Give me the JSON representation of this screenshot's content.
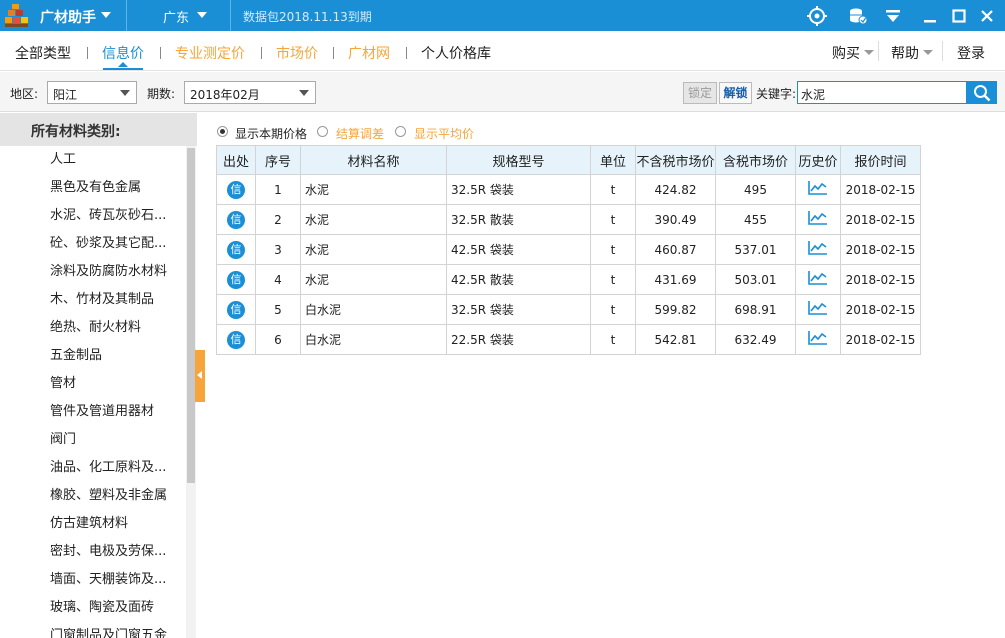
{
  "titlebar": {
    "app_name": "广材助手",
    "region": "广东",
    "package_text": "数据包2018.11.13到期",
    "icons": [
      "target-icon",
      "database-icon",
      "download-icon",
      "minimize-icon",
      "maximize-icon",
      "close-icon"
    ]
  },
  "nav": {
    "tabs": [
      "全部类型",
      "信息价",
      "专业测定价",
      "市场价",
      "广材网",
      "个人价格库"
    ],
    "active_tab": "信息价",
    "buy_label": "购买",
    "help_label": "帮助",
    "login_label": "登录"
  },
  "filter": {
    "area_label": "地区:",
    "area_value": "阳江",
    "period_label": "期数:",
    "period_value": "2018年02月",
    "lock_label": "锁定",
    "unlock_label": "解锁",
    "keyword_label": "关键字:",
    "keyword_value": "水泥"
  },
  "sidebar": {
    "header": "所有材料类别:",
    "items": [
      "人工",
      "黑色及有色金属",
      "水泥、砖瓦灰砂石...",
      "砼、砂浆及其它配...",
      "涂料及防腐防水材料",
      "木、竹材及其制品",
      "绝热、耐火材料",
      "五金制品",
      "管材",
      "管件及管道用器材",
      "阀门",
      "油品、化工原料及...",
      "橡胶、塑料及非金属",
      "仿古建筑材料",
      "密封、电极及劳保...",
      "墙面、天棚装饰及...",
      "玻璃、陶瓷及面砖",
      "门窗制品及门窗五金"
    ]
  },
  "options": {
    "show_current": "显示本期价格",
    "settlement": "结算调差",
    "show_average": "显示平均价"
  },
  "table": {
    "columns": [
      "出处",
      "序号",
      "材料名称",
      "规格型号",
      "单位",
      "不含税市场价",
      "含税市场价",
      "历史价",
      "报价时间"
    ],
    "source_badge": "信",
    "rows": [
      {
        "no": "1",
        "name": "水泥",
        "spec": "32.5R 袋装",
        "unit": "t",
        "price_ex": "424.82",
        "price_inc": "495",
        "date": "2018-02-15"
      },
      {
        "no": "2",
        "name": "水泥",
        "spec": "32.5R 散装",
        "unit": "t",
        "price_ex": "390.49",
        "price_inc": "455",
        "date": "2018-02-15"
      },
      {
        "no": "3",
        "name": "水泥",
        "spec": "42.5R 袋装",
        "unit": "t",
        "price_ex": "460.87",
        "price_inc": "537.01",
        "date": "2018-02-15"
      },
      {
        "no": "4",
        "name": "水泥",
        "spec": "42.5R 散装",
        "unit": "t",
        "price_ex": "431.69",
        "price_inc": "503.01",
        "date": "2018-02-15"
      },
      {
        "no": "5",
        "name": "白水泥",
        "spec": "32.5R 袋装",
        "unit": "t",
        "price_ex": "599.82",
        "price_inc": "698.91",
        "date": "2018-02-15"
      },
      {
        "no": "6",
        "name": "白水泥",
        "spec": "22.5R 袋装",
        "unit": "t",
        "price_ex": "542.81",
        "price_inc": "632.49",
        "date": "2018-02-15"
      }
    ]
  },
  "colors": {
    "titlebar_bg": "#1a8fd6",
    "accent_orange": "#f7a53a",
    "header_bg": "#e6f3fb"
  }
}
